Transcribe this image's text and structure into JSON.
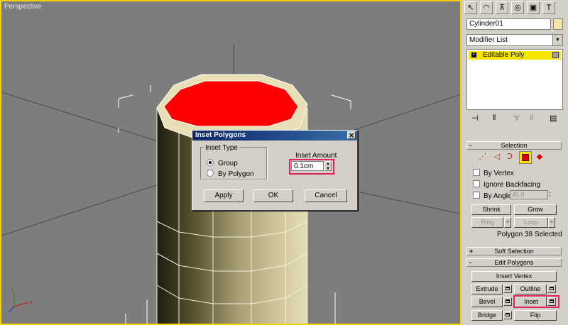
{
  "viewport": {
    "label": "Perspective"
  },
  "dialog": {
    "title": "Inset Polygons",
    "close_glyph": "✕",
    "inset_type_legend": "Inset Type",
    "radio_group": "Group",
    "radio_by_polygon": "By Polygon",
    "inset_amount_label": "Inset Amount",
    "inset_amount_value": "0.1cm",
    "apply_label": "Apply",
    "ok_label": "OK",
    "cancel_label": "Cancel"
  },
  "panel": {
    "object_name": "Cylinder01",
    "modifier_list": "Modifier List",
    "stack_item": "Editable Poly",
    "selection": {
      "header": "Selection",
      "by_vertex": "By Vertex",
      "ignore_backfacing": "Ignore Backfacing",
      "by_angle": "By Angle:",
      "angle_value": "45.0",
      "shrink": "Shrink",
      "grow": "Grow",
      "ring": "Ring",
      "loop": "Loop",
      "status": "Polygon 38 Selected"
    },
    "soft_selection": "Soft Selection",
    "edit_polygons": {
      "header": "Edit Polygons",
      "insert_vertex": "Insert Vertex",
      "extrude": "Extrude",
      "outline": "Outline",
      "bevel": "Bevel",
      "inset": "Inset",
      "bridge": "Bridge",
      "flip": "Flip"
    },
    "rollout_plus": "+",
    "rollout_minus": "-"
  },
  "colors": {
    "selection_red": "#ff0000",
    "viewport_border": "#f2d300",
    "highlight": "#e0245e"
  }
}
